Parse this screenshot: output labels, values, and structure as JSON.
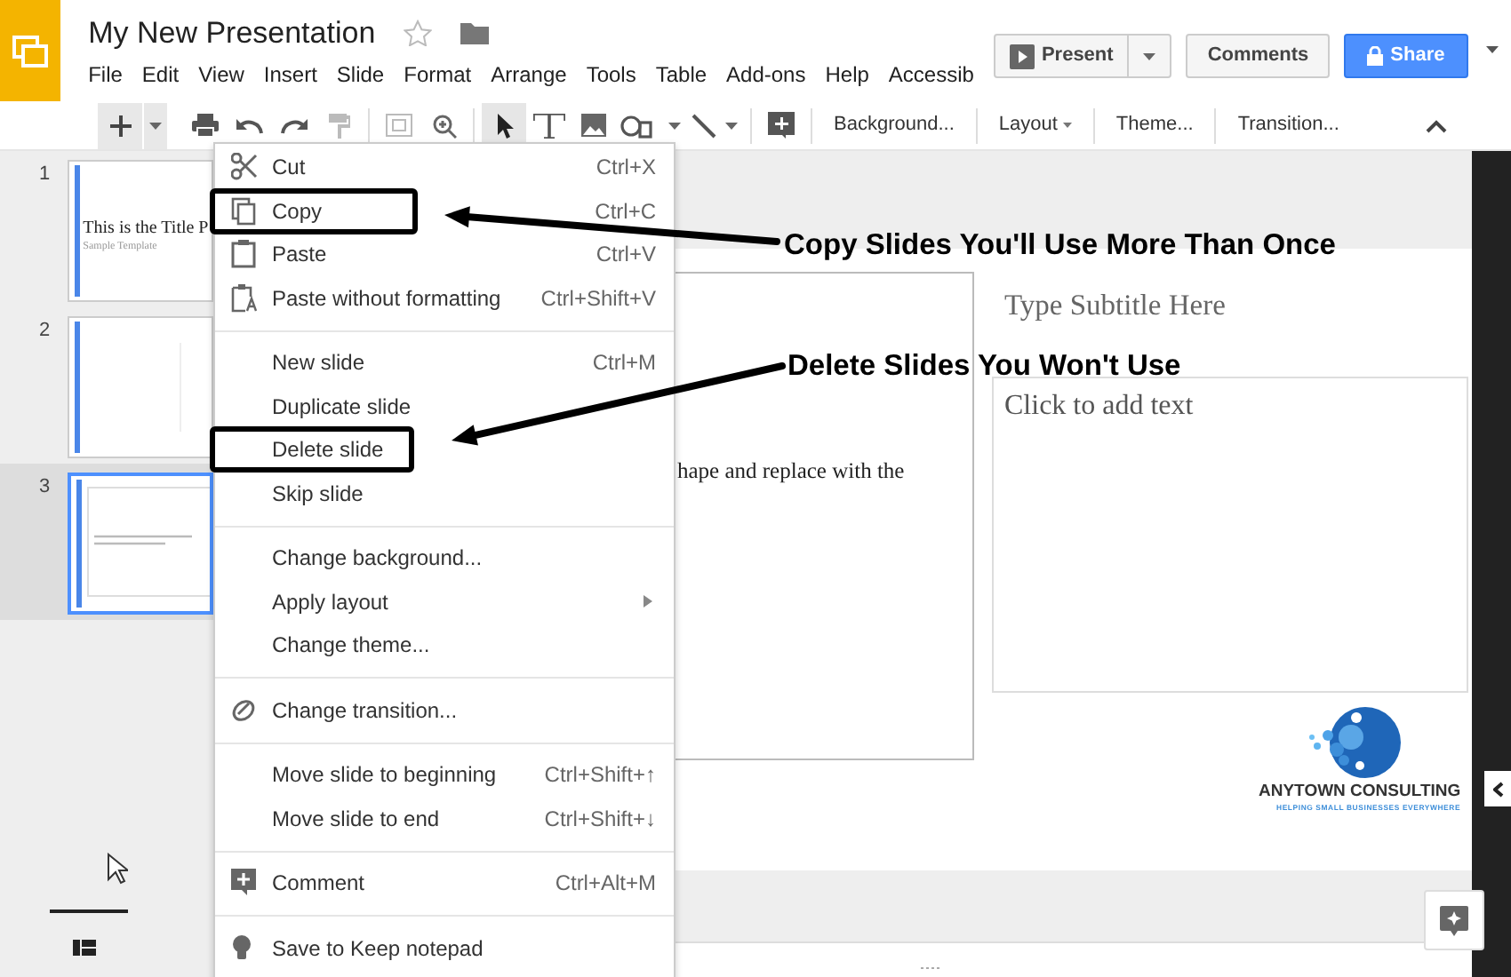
{
  "app": {
    "title": "My New Presentation",
    "starred": false
  },
  "menu": [
    "File",
    "Edit",
    "View",
    "Insert",
    "Slide",
    "Format",
    "Arrange",
    "Tools",
    "Table",
    "Add-ons",
    "Help",
    "Accessib"
  ],
  "header_buttons": {
    "present": "Present",
    "comments": "Comments",
    "share": "Share"
  },
  "toolbar": {
    "tools": [
      {
        "selected": true
      },
      {
        "selected": false
      },
      {
        "selected": false
      },
      {
        "selected": false
      },
      {
        "selected": false
      }
    ],
    "text_buttons": [
      {
        "label": "Background...",
        "dropdown": false
      },
      {
        "label": "Layout",
        "dropdown": true
      },
      {
        "label": "Theme...",
        "dropdown": false
      },
      {
        "label": "Transition...",
        "dropdown": false
      }
    ]
  },
  "slides": [
    {
      "number": "1",
      "selected": false,
      "title": "This is the Title P",
      "subtitle": "Sample Template"
    },
    {
      "number": "2",
      "selected": false
    },
    {
      "number": "3",
      "selected": true
    }
  ],
  "context_menu": {
    "items": [
      {
        "kind": "item",
        "label": "Cut",
        "shortcut": "Ctrl+X",
        "highlighted": false
      },
      {
        "kind": "item",
        "label": "Copy",
        "shortcut": "Ctrl+C",
        "highlighted": true
      },
      {
        "kind": "item",
        "label": "Paste",
        "shortcut": "Ctrl+V",
        "highlighted": false
      },
      {
        "kind": "item",
        "label": "Paste without formatting",
        "shortcut": "Ctrl+Shift+V",
        "highlighted": false
      },
      {
        "kind": "divider"
      },
      {
        "kind": "item",
        "label": "New slide",
        "shortcut": "Ctrl+M",
        "highlighted": false
      },
      {
        "kind": "item",
        "label": "Duplicate slide",
        "highlighted": false
      },
      {
        "kind": "item",
        "label": "Delete slide",
        "highlighted": true
      },
      {
        "kind": "item",
        "label": "Skip slide",
        "highlighted": false
      },
      {
        "kind": "divider"
      },
      {
        "kind": "item",
        "label": "Change background...",
        "highlighted": false
      },
      {
        "kind": "item",
        "label": "Apply layout",
        "submenu": true,
        "highlighted": false
      },
      {
        "kind": "item",
        "label": "Change theme...",
        "highlighted": false
      },
      {
        "kind": "divider"
      },
      {
        "kind": "item",
        "label": "Change transition...",
        "highlighted": false
      },
      {
        "kind": "divider"
      },
      {
        "kind": "item",
        "label": "Move slide to beginning",
        "shortcut": "Ctrl+Shift+↑",
        "highlighted": false
      },
      {
        "kind": "item",
        "label": "Move slide to end",
        "shortcut": "Ctrl+Shift+↓",
        "highlighted": false
      },
      {
        "kind": "divider"
      },
      {
        "kind": "item",
        "label": "Comment",
        "shortcut": "Ctrl+Alt+M",
        "highlighted": false
      },
      {
        "kind": "divider"
      },
      {
        "kind": "item",
        "label": "Save to Keep notepad",
        "highlighted": false
      }
    ]
  },
  "annotations": [
    {
      "text": "Copy Slides You'll Use More Than Once"
    },
    {
      "text": "Delete Slides You Won't Use"
    }
  ],
  "slide": {
    "body_fragment": "hape and replace with the",
    "subtitle_placeholder": "Type Subtitle Here",
    "text_placeholder": "Click to add text",
    "logo_name": "ANYTOWN CONSULTING",
    "logo_tagline": "HELPING SMALL BUSINESSES EVERYWHERE"
  }
}
